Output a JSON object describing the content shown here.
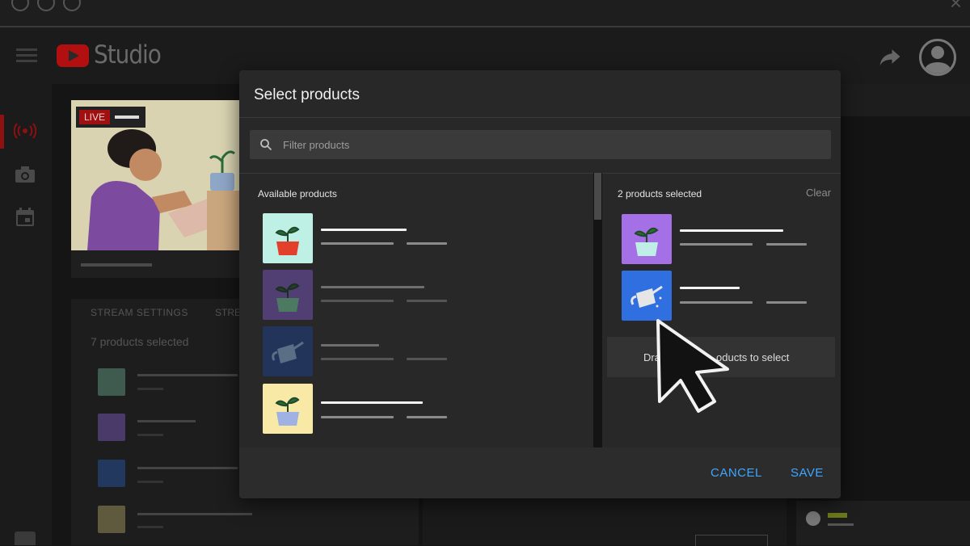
{
  "app": {
    "title": "Studio",
    "brand_color": "#b21010"
  },
  "rail": {
    "items": [
      {
        "icon": "live-broadcast-icon",
        "active": true
      },
      {
        "icon": "camera-icon",
        "active": false
      },
      {
        "icon": "calendar-icon",
        "active": false
      }
    ]
  },
  "background": {
    "live_badge": "LIVE",
    "tabs": [
      "STREAM SETTINGS",
      "STRE"
    ],
    "products_selected": "7 products selected"
  },
  "modal": {
    "title": "Select products",
    "filter_placeholder": "Filter products",
    "available_header": "Available products",
    "selected_header": "2 products selected",
    "clear_label": "Clear",
    "drop_hint": "Drag products to select",
    "drop_hint_left": "Dra",
    "drop_hint_right": "oducts to select",
    "cancel_label": "CANCEL",
    "save_label": "SAVE",
    "accent_color": "#3ea6ff",
    "available_products": [
      {
        "icon": "plant-pot-icon",
        "bg": "#bff0e6",
        "pot": "#e2402a"
      },
      {
        "icon": "plant-pot-icon",
        "bg": "#513e72",
        "pot": "#4c7a61"
      },
      {
        "icon": "watering-can-icon",
        "bg": "#23345a",
        "pot": "#5a6e86"
      },
      {
        "icon": "plant-pot-icon",
        "bg": "#f8eaa6",
        "pot": "#9fb2e3"
      }
    ],
    "selected_products": [
      {
        "icon": "plant-pot-icon",
        "bg": "#a56fe6",
        "pot": "#bfeee6"
      },
      {
        "icon": "watering-can-icon",
        "bg": "#2f6fe0",
        "pot": "#e6e6e6"
      }
    ]
  }
}
